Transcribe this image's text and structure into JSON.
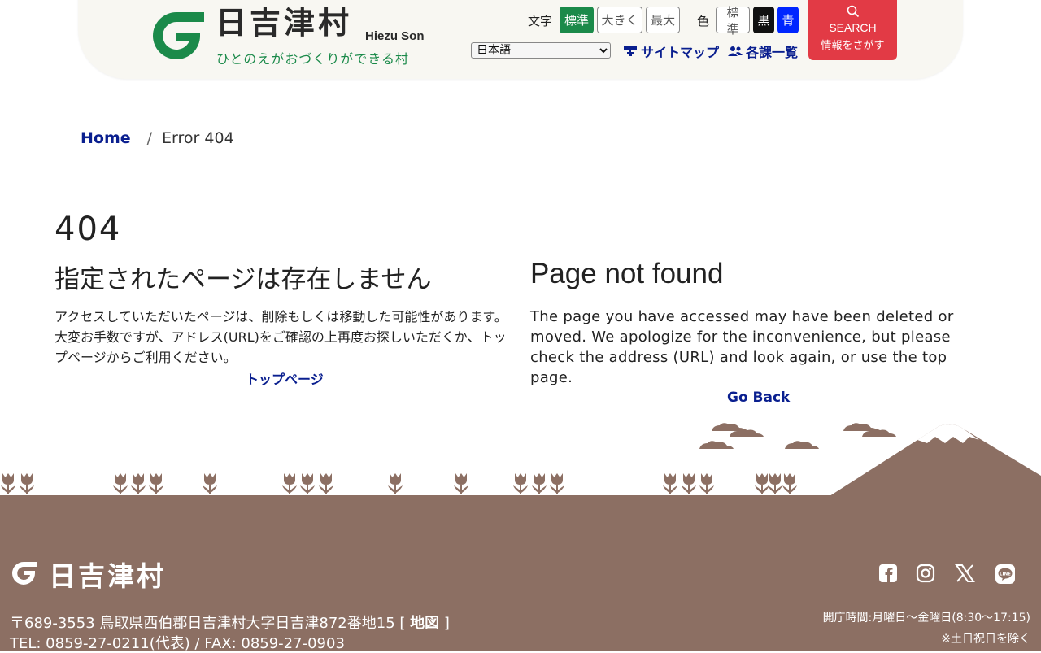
{
  "header": {
    "title": "日吉津村",
    "romanized": "Hiezu Son",
    "tagline": "ひとのえがおづくりができる村",
    "text_size_label": "文字",
    "text_size_options": [
      "標準",
      "大きく",
      "最大"
    ],
    "text_size_selected": "標準",
    "color_label": "色",
    "color_options": [
      "標準",
      "黒",
      "青"
    ],
    "language_selected": "日本語",
    "sitemap_link": "サイトマップ",
    "departments_link": "各課一覧",
    "search_label": "SEARCH",
    "search_sub": "情報をさがす",
    "colors": {
      "brand_green": "#1b8a4a",
      "search_red": "#e23a45",
      "link_navy": "#0a1f8f"
    }
  },
  "breadcrumb": {
    "home": "Home",
    "separator": "/",
    "current": "Error 404"
  },
  "main": {
    "code": "404",
    "ja": {
      "title": "指定されたページは存在しません",
      "body": "アクセスしていただいたページは、削除もしくは移動した可能性があります。大変お手数ですが、アドレス(URL)をご確認の上再度お探しいただくか、トップページからご利用ください。",
      "link": "トップページ"
    },
    "en": {
      "title": "Page not found",
      "body": "The page you have accessed may have been deleted or moved. We apologize for the inconvenience, but please check the address (URL) and look again, or use the top page.",
      "link": "Go Back"
    }
  },
  "footer": {
    "name": "日吉津村",
    "address": "〒689-3553 鳥取県西伯郡日吉津村大字日吉津872番地15 [",
    "map_link": "地図",
    "address_close": "]",
    "tel": "TEL: 0859-27-0211(代表) / FAX: 0859-27-0903",
    "hours": "開庁時間:月曜日〜金曜日(8:30〜17:15)",
    "hours_note": "※土日祝日を除く",
    "social_icons": [
      "facebook-icon",
      "instagram-icon",
      "x-icon",
      "line-icon"
    ],
    "background": "#8c6f63"
  }
}
